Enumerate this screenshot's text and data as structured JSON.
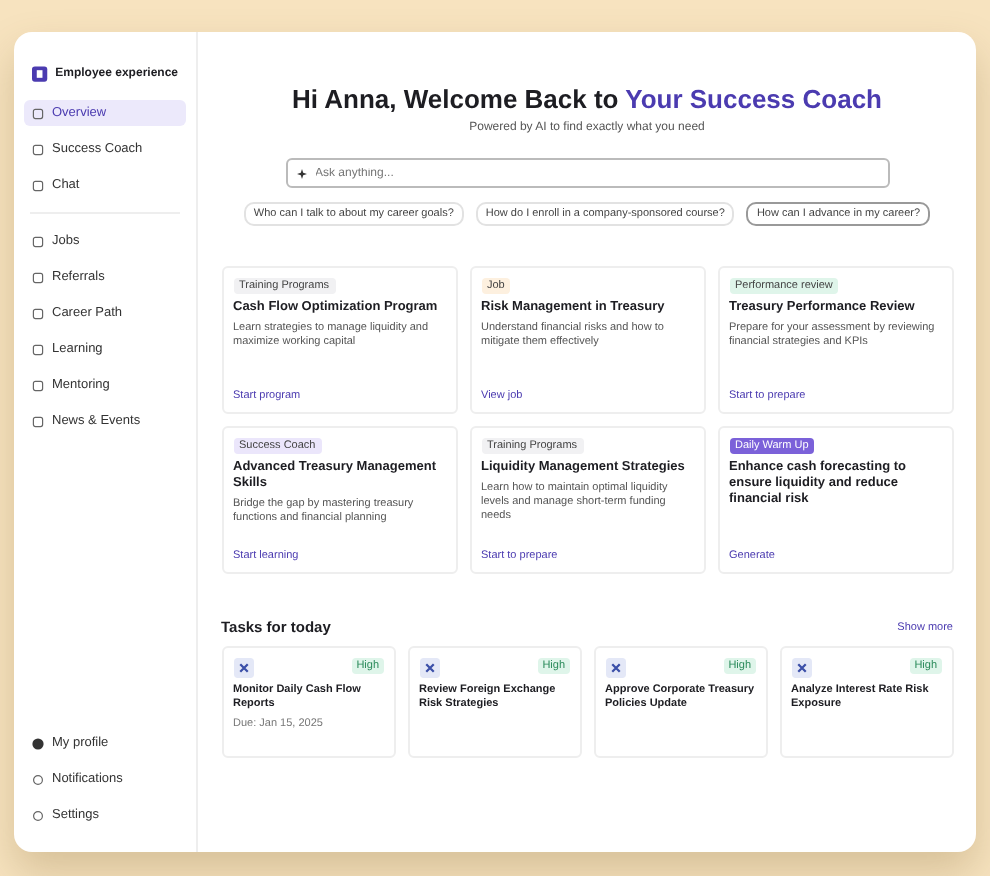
{
  "brand": "Employee experience",
  "nav": [
    {
      "label": "Overview",
      "selected": true
    },
    {
      "label": "Success Coach",
      "selected": false
    },
    {
      "label": "Chat",
      "selected": false
    }
  ],
  "nav_secondary": [
    {
      "label": "Jobs",
      "selected": false
    },
    {
      "label": "Referrals",
      "selected": false
    },
    {
      "label": "Career Path",
      "selected": false
    },
    {
      "label": "Learning",
      "selected": false
    },
    {
      "label": "Mentoring",
      "selected": false
    },
    {
      "label": "News & Events",
      "selected": false
    }
  ],
  "nav_bottom": [
    {
      "label": "My profile",
      "kind": "avatar"
    },
    {
      "label": "Notifications",
      "kind": "icon"
    },
    {
      "label": "Settings",
      "kind": "icon"
    }
  ],
  "heading": "Hi Anna, Welcome Back to",
  "heading_highlight": "Your Success Coach",
  "subtitle": "Powered by AI to find exactly what you need",
  "search": {
    "placeholder": "Ask anything..."
  },
  "suggestions": [
    {
      "label": "Who can I talk to about my career goals?",
      "selected": false
    },
    {
      "label": "How do I enroll in a company-sponsored course?",
      "selected": false
    },
    {
      "label": "How can I advance in my career?",
      "selected": true
    }
  ],
  "cards": [
    {
      "tag": "Training Programs",
      "kind": "light",
      "color": "#f1f1f3",
      "title": "Cash Flow Optimization Program",
      "description": "Learn strategies to manage liquidity and maximize working capital",
      "action": "Start program"
    },
    {
      "tag": "Job",
      "kind": "light",
      "color": "#fdf0df",
      "title": "Risk Management in Treasury",
      "description": "Understand financial risks and how to mitigate them effectively",
      "action": "View job"
    },
    {
      "tag": "Performance review",
      "kind": "light",
      "color": "#dff5ea",
      "title": "Treasury Performance Review",
      "description": "Prepare for your assessment by reviewing financial strategies and KPIs",
      "action": "Start to prepare"
    },
    {
      "tag": "Success Coach",
      "kind": "light",
      "color": "#ebe6fb",
      "title": "Advanced Treasury Management Skills",
      "description": "Bridge the gap by mastering treasury functions and financial planning",
      "action": "Start learning"
    },
    {
      "tag": "Training Programs",
      "kind": "light",
      "color": "#f1f1f3",
      "title": "Liquidity Management Strategies",
      "description": "Learn how to maintain optimal liquidity levels and manage short-term funding needs",
      "action": "Start to prepare"
    },
    {
      "tag": "Daily Warm Up",
      "kind": "solid",
      "color": "#7b61d9",
      "title": "Enhance cash forecasting to ensure liquidity and reduce financial risk",
      "action": "Generate"
    }
  ],
  "tasks_title": "Tasks for today",
  "show_more": "Show more",
  "tasks": [
    {
      "priority": "High",
      "title": "Monitor Daily Cash Flow Reports",
      "due": "Due: Jan 15, 2025"
    },
    {
      "priority": "High",
      "title": "Review Foreign Exchange Risk Strategies"
    },
    {
      "priority": "High",
      "title": "Approve Corporate Treasury Policies Update"
    },
    {
      "priority": "High",
      "title": "Analyze Interest Rate Risk Exposure"
    }
  ]
}
